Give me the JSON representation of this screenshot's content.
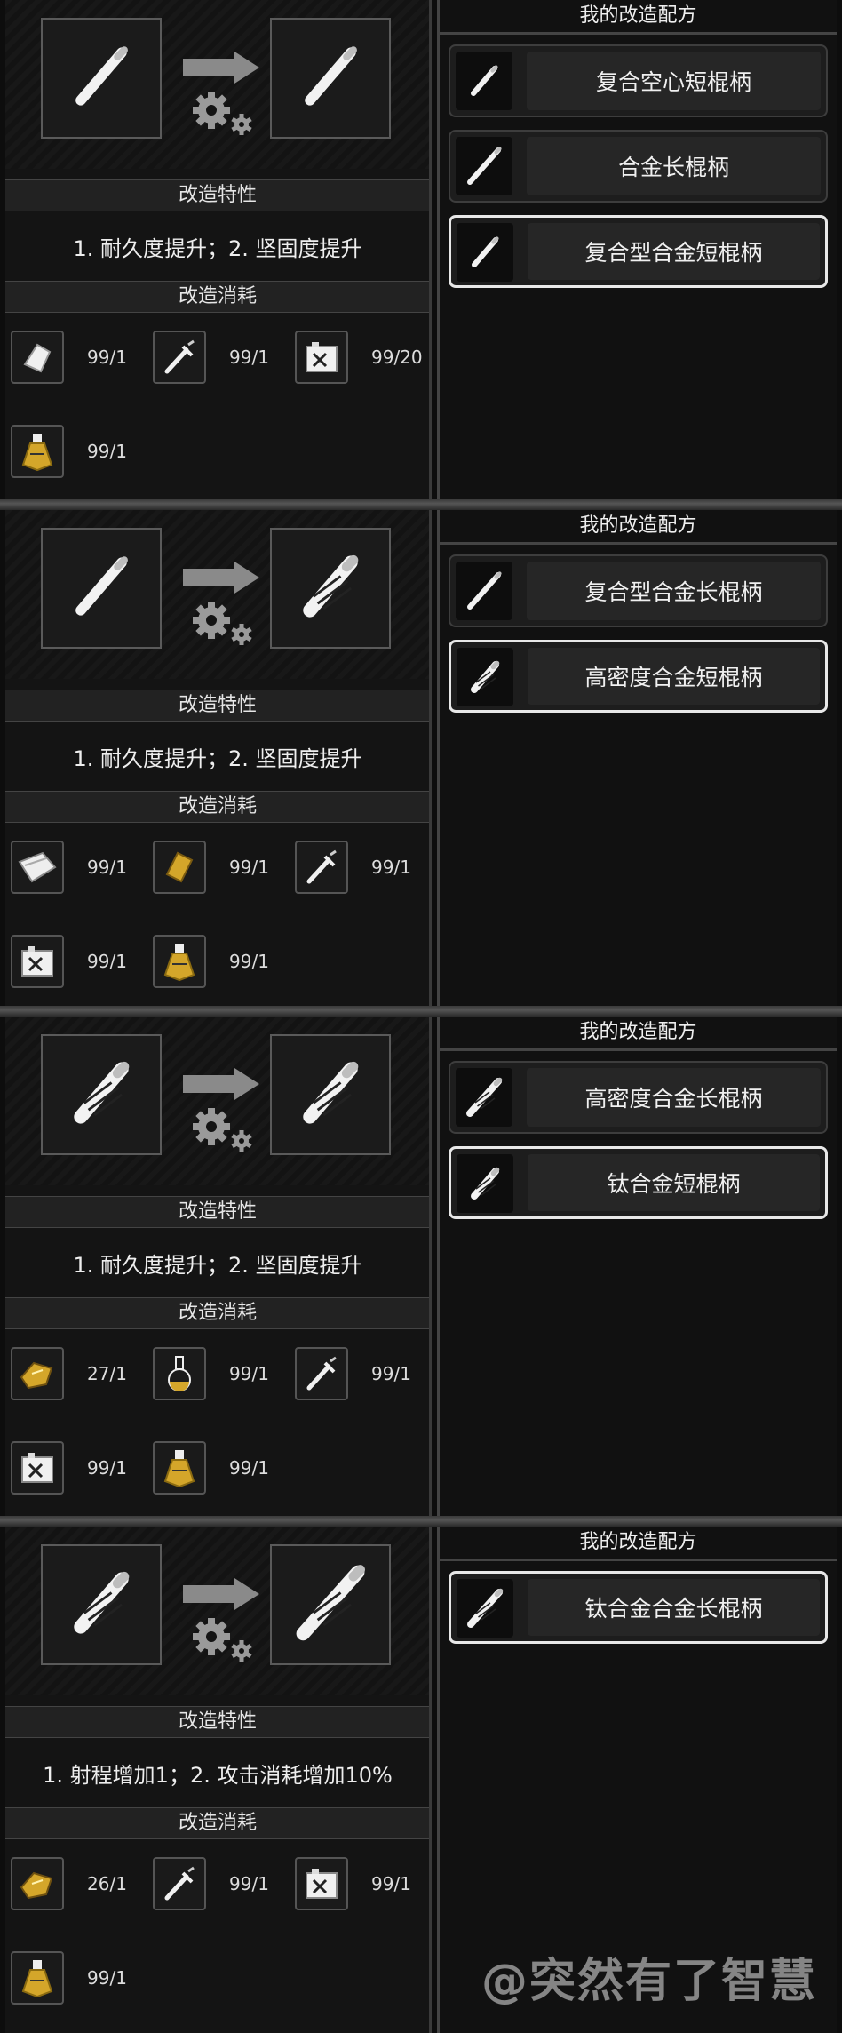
{
  "labels": {
    "traits": "改造特性",
    "costs": "改造消耗",
    "recipes_title": "我的改造配方"
  },
  "panels": [
    {
      "trait_text": "1. 耐久度提升；2. 坚固度提升",
      "input_icon": "short-handle-icon",
      "output_icon": "hollow-short-handle-icon",
      "materials": [
        {
          "icon": "metal-plate-icon",
          "count": "99/1"
        },
        {
          "icon": "screwdriver-icon",
          "count": "99/1"
        },
        {
          "icon": "battery-icon",
          "count": "99/20"
        },
        {
          "icon": "potion-flask-icon",
          "count": "99/1"
        }
      ],
      "recipes": [
        {
          "label": "复合空心短棍柄",
          "icon": "hollow-short-handle-icon"
        },
        {
          "label": "合金长棍柄",
          "icon": "long-handle-icon"
        },
        {
          "label": "复合型合金短棍柄",
          "icon": "composite-short-handle-icon"
        }
      ]
    },
    {
      "trait_text": "1. 耐久度提升；2. 坚固度提升",
      "input_icon": "composite-short-handle-icon",
      "output_icon": "dense-short-handle-icon",
      "materials": [
        {
          "icon": "metal-sheet-icon",
          "count": "99/1"
        },
        {
          "icon": "gold-bar-icon",
          "count": "99/1"
        },
        {
          "icon": "screwdriver-icon",
          "count": "99/1"
        },
        {
          "icon": "battery-icon",
          "count": "99/1"
        },
        {
          "icon": "potion-flask-icon",
          "count": "99/1"
        }
      ],
      "recipes": [
        {
          "label": "复合型合金长棍柄",
          "icon": "composite-long-handle-icon"
        },
        {
          "label": "高密度合金短棍柄",
          "icon": "dense-short-handle-icon"
        }
      ]
    },
    {
      "trait_text": "1. 耐久度提升；2. 坚固度提升",
      "input_icon": "dense-short-handle-icon",
      "output_icon": "titanium-short-handle-icon",
      "materials": [
        {
          "icon": "gold-chunk-icon",
          "count": "27/1"
        },
        {
          "icon": "round-flask-icon",
          "count": "99/1"
        },
        {
          "icon": "screwdriver-icon",
          "count": "99/1"
        },
        {
          "icon": "battery-icon",
          "count": "99/1"
        },
        {
          "icon": "potion-flask-icon",
          "count": "99/1"
        }
      ],
      "recipes": [
        {
          "label": "高密度合金长棍柄",
          "icon": "dense-long-handle-icon"
        },
        {
          "label": "钛合金短棍柄",
          "icon": "titanium-short-handle-icon"
        }
      ]
    },
    {
      "trait_text": "1. 射程增加1；2. 攻击消耗增加10%",
      "input_icon": "titanium-short-handle-icon",
      "output_icon": "titanium-long-handle-icon",
      "materials": [
        {
          "icon": "gold-chunk-icon",
          "count": "26/1"
        },
        {
          "icon": "screwdriver-icon",
          "count": "99/1"
        },
        {
          "icon": "battery-icon",
          "count": "99/1"
        },
        {
          "icon": "potion-flask-icon",
          "count": "99/1"
        }
      ],
      "recipes": [
        {
          "label": "钛合金合金长棍柄",
          "icon": "titanium-long-handle-icon"
        }
      ]
    }
  ],
  "watermark": "@突然有了智慧",
  "colors": {
    "selected_border": "#e8e8e8",
    "gold": "#d4a62a"
  }
}
